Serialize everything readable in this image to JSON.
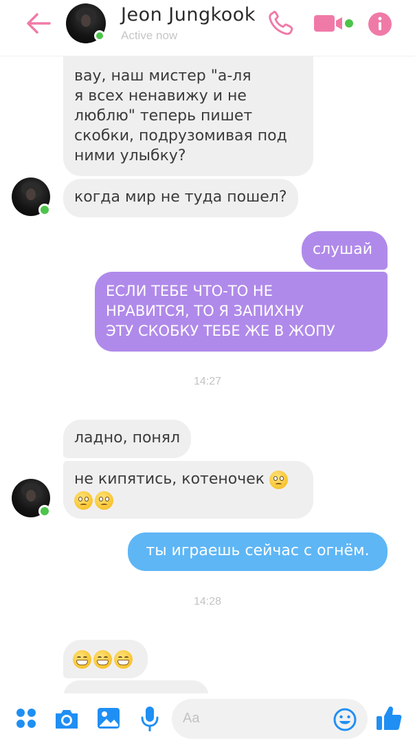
{
  "header": {
    "contact_name": "Jeon Jungkook",
    "status": "Active now",
    "icons": [
      "back-arrow-icon",
      "phone-icon",
      "video-camera-icon",
      "info-icon"
    ]
  },
  "messages": [
    {
      "side": "in",
      "text_lines": [
        "вау, наш мистер \"а-ля",
        "я всех ненавижу и не",
        "люблю\" теперь пишет",
        "скобки, подрузомивая под",
        "ними улыбку?"
      ]
    },
    {
      "side": "in",
      "text": "когда мир не туда пошел?"
    },
    {
      "side": "out",
      "text": "слушай"
    },
    {
      "side": "out",
      "text_lines": [
        "ЕСЛИ ТЕБЕ ЧТО-ТО НЕ",
        "НРАВИТСЯ, ТО Я ЗАПИХНУ",
        "ЭТУ СКОБКУ ТЕБЕ ЖЕ В ЖОПУ"
      ]
    },
    {
      "timestamp": "14:27"
    },
    {
      "side": "in",
      "text": "ладно, понял"
    },
    {
      "side": "in",
      "text": "не кипятись, котеночек",
      "emojis": [
        "pleading-face",
        "pleading-face",
        "pleading-face"
      ]
    },
    {
      "side": "out",
      "text": "ты играешь сейчас с огнём."
    },
    {
      "timestamp": "14:28"
    },
    {
      "side": "in",
      "emojis": [
        "grinning-face",
        "grinning-face",
        "grinning-face"
      ]
    }
  ],
  "composer": {
    "placeholder": "Aa",
    "icons": [
      "apps-grid-icon",
      "camera-icon",
      "image-icon",
      "microphone-icon",
      "emoji-icon",
      "thumbs-up-icon"
    ]
  },
  "colors": {
    "accent_pink": "#f07aa7",
    "bubble_incoming": "#f0eff0",
    "bubble_purple": "#b08aea",
    "bubble_blue": "#5eb6f5",
    "icon_blue": "#1f8ff3",
    "online": "#4cc44a"
  }
}
